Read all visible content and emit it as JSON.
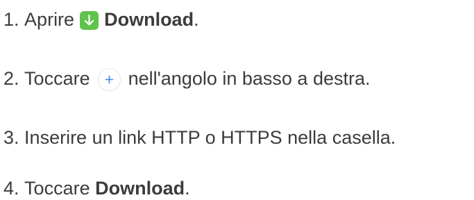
{
  "steps": [
    {
      "number": "1.",
      "before": "Aprire",
      "icon": "download-app-icon",
      "bold": "Download",
      "after": "."
    },
    {
      "number": "2.",
      "before": "Toccare",
      "icon": "plus-button-icon",
      "after": "nell'angolo in basso a destra."
    },
    {
      "number": "3.",
      "text": "Inserire un link HTTP o HTTPS nella casella."
    },
    {
      "number": "4.",
      "before": "Toccare",
      "bold": "Download",
      "after": "."
    }
  ],
  "colors": {
    "text": "#3c3c3c",
    "download_icon_bg": "#5fc24a",
    "plus_icon_color": "#3b82f6"
  }
}
